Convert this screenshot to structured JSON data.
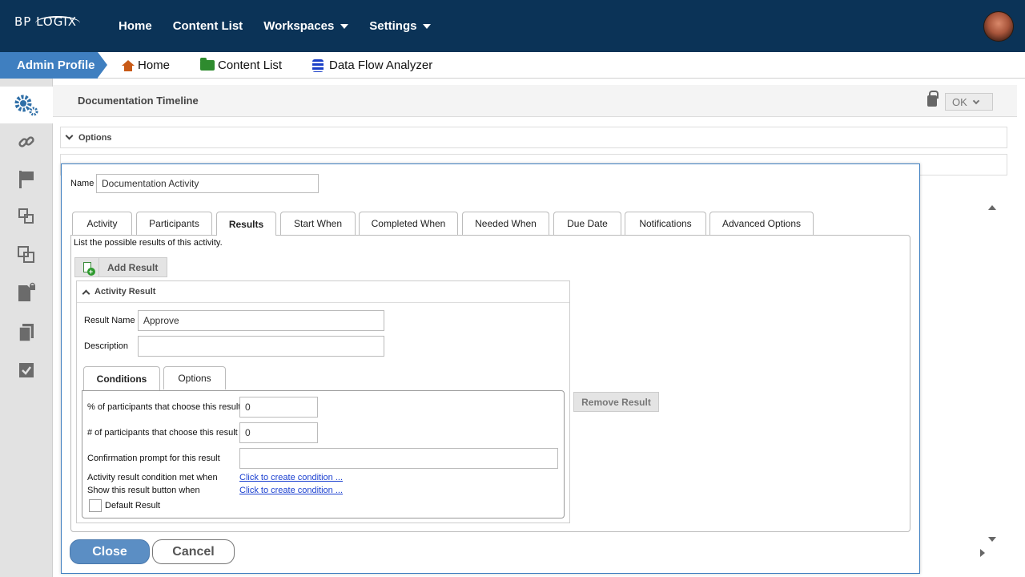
{
  "brand": {
    "logo_text": "BP LOGIX"
  },
  "topnav": {
    "items": [
      {
        "label": "Home",
        "has_caret": false
      },
      {
        "label": "Content List",
        "has_caret": false
      },
      {
        "label": "Workspaces",
        "has_caret": true
      },
      {
        "label": "Settings",
        "has_caret": true
      }
    ]
  },
  "breadcrumb": {
    "admin_label": "Admin Profile",
    "items": [
      {
        "label": "Home",
        "icon": "home-icon"
      },
      {
        "label": "Content List",
        "icon": "folder-icon"
      },
      {
        "label": "Data Flow Analyzer",
        "icon": "database-icon"
      }
    ]
  },
  "sidebar": {
    "items": [
      {
        "icon": "gears-icon",
        "active": true
      },
      {
        "icon": "link-icon",
        "active": false
      },
      {
        "icon": "flag-icon",
        "active": false
      },
      {
        "icon": "move-icon",
        "active": false
      },
      {
        "icon": "copy-icon",
        "active": false
      },
      {
        "icon": "locked-document-icon",
        "active": false
      },
      {
        "icon": "documents-icon",
        "active": false
      },
      {
        "icon": "checklist-icon",
        "active": false
      }
    ]
  },
  "page": {
    "title": "Documentation Timeline",
    "ok_label": "OK",
    "options_label": "Options"
  },
  "dialog": {
    "name_label": "Name",
    "name_value": "Documentation Activity",
    "tabs": [
      {
        "label": "Activity"
      },
      {
        "label": "Participants"
      },
      {
        "label": "Results",
        "active": true
      },
      {
        "label": "Start When"
      },
      {
        "label": "Completed When"
      },
      {
        "label": "Needed When"
      },
      {
        "label": "Due Date"
      },
      {
        "label": "Notifications"
      },
      {
        "label": "Advanced Options"
      }
    ],
    "results": {
      "description": "List the possible results of this activity.",
      "add_result_label": "Add Result",
      "section_title": "Activity Result",
      "result_name_label": "Result Name",
      "result_name_value": "Approve",
      "description_label": "Description",
      "description_value": "",
      "subtabs": [
        {
          "label": "Conditions",
          "active": true
        },
        {
          "label": "Options",
          "active": false
        }
      ],
      "conditions": {
        "pct_label": "% of participants that choose this result",
        "pct_value": "0",
        "count_label": "# of participants that choose this result",
        "count_value": "0",
        "confirm_label": "Confirmation prompt for this result",
        "confirm_value": "",
        "met_label": "Activity result condition met when",
        "met_link": "Click to create condition ...",
        "show_label": "Show this result button when",
        "show_link": "Click to create condition ...",
        "default_label": "Default Result",
        "default_checked": false
      },
      "remove_result_label": "Remove Result"
    },
    "close_label": "Close",
    "cancel_label": "Cancel"
  },
  "colors": {
    "topbar": "#0b3357",
    "accent": "#3f7fc0",
    "close_button": "#5b8ec4",
    "link": "#1a3fd0"
  }
}
